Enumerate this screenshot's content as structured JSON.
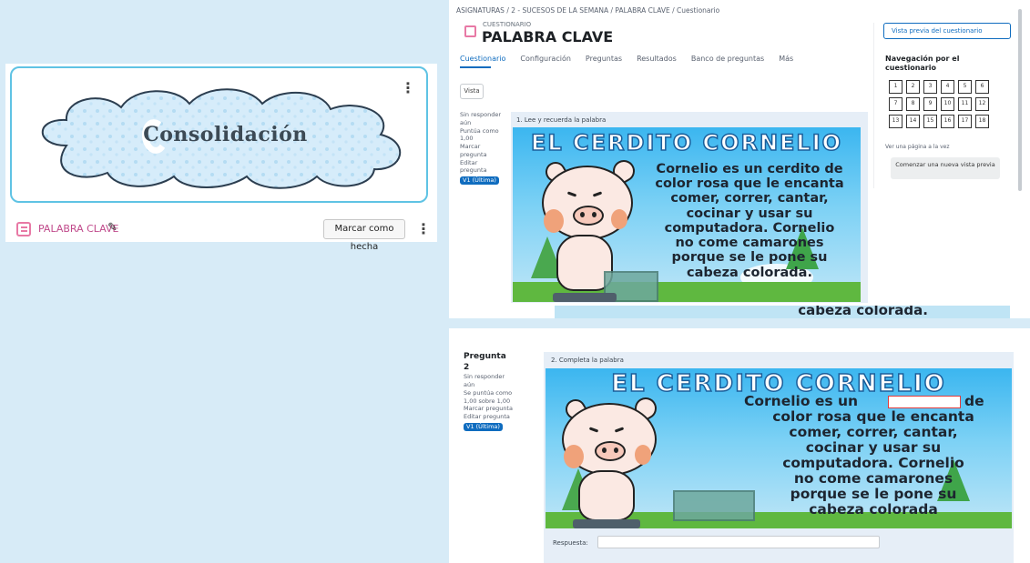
{
  "card": {
    "banner_title": "Consolidación",
    "activity_name": "PALABRA CLAVE",
    "mark_done_label": "Marcar como hecha",
    "menu_glyph": "⋮"
  },
  "quiz": {
    "breadcrumb": "ASIGNATURAS / 2 - SUCESOS DE LA SEMANA / PALABRA CLAVE / Cuestionario",
    "type_label": "CUESTIONARIO",
    "title": "PALABRA CLAVE",
    "tabs": [
      "Cuestionario",
      "Configuración",
      "Preguntas",
      "Resultados",
      "Banco de preguntas",
      "Más"
    ],
    "mode_select": "Vista",
    "preview_button": "Vista previa del cuestionario",
    "nav_title": "Navegación por el cuestionario",
    "nav_cells": [
      "1",
      "2",
      "3",
      "4",
      "5",
      "6",
      "7",
      "8",
      "9",
      "10",
      "11",
      "12",
      "13",
      "14",
      "15",
      "16",
      "17",
      "18"
    ],
    "nav_link": "Ver una página a la vez",
    "new_preview_button": "Comenzar una nueva vista previa",
    "q1": {
      "info": [
        "Sin responder aún",
        "Puntúa como 1,00",
        "Marcar pregunta",
        "Editar pregunta"
      ],
      "badge": "V1 (Última)",
      "prompt": "1. Lee y recuerda la palabra"
    },
    "q2": {
      "number": "Pregunta 2",
      "info": [
        "Sin responder aún",
        "Se puntúa como 1,00 sobre 1,00",
        "Marcar pregunta",
        "Editar pregunta"
      ],
      "badge": "V1 (Última)",
      "prompt": "2. Completa la palabra",
      "answer_label": "Respuesta:"
    },
    "story": {
      "title": "EL CERDITO CORNELIO",
      "text_lines": [
        "Cornelio es un cerdito de",
        "color rosa que le encanta",
        "comer, correr, cantar,",
        "cocinar y usar su",
        "computadora. Cornelio",
        "no come camarones",
        "porque se le pone su",
        "cabeza colorada."
      ],
      "text_lines_blank": [
        "Cornelio es un",
        "de",
        "color rosa que le encanta",
        "comer, correr, cantar,",
        "cocinar y usar su",
        "computadora. Cornelio",
        "no come camarones",
        "porque se le pone su",
        "cabeza colorada"
      ],
      "peek_text": "cabeza colorada."
    }
  },
  "colors": {
    "accent": "#0f6cbf",
    "quiz_icon": "#e879a5",
    "background": "#d7ebf7"
  }
}
